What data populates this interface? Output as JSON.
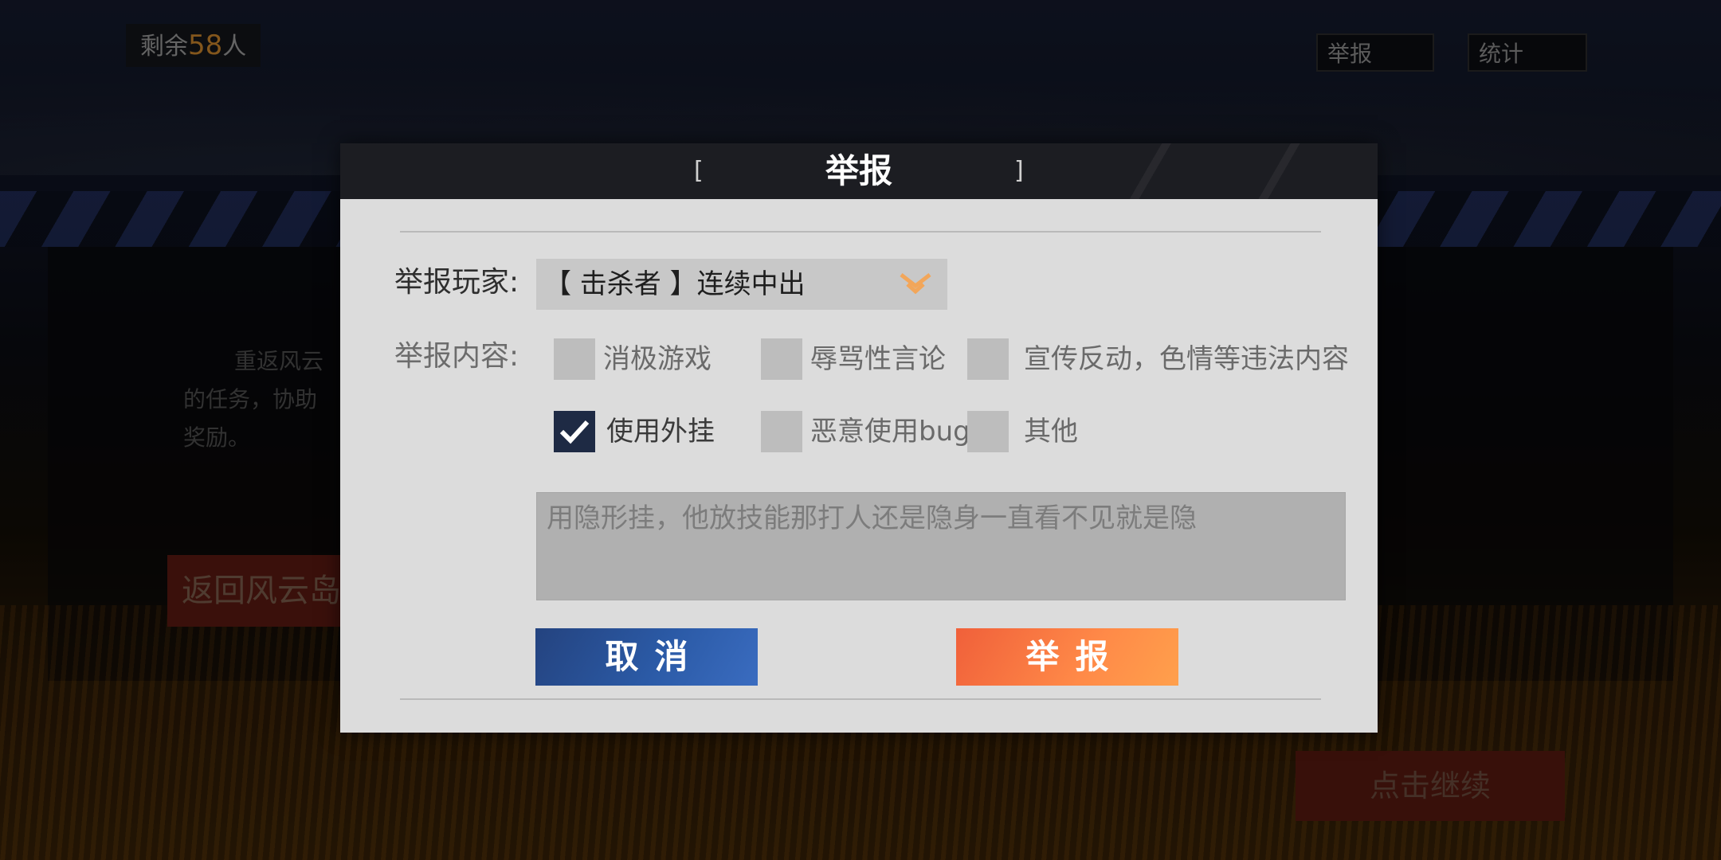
{
  "hud": {
    "remaining_prefix": "剩余",
    "remaining_count": "58",
    "remaining_suffix": "人",
    "report_label": "举报",
    "stats_label": "统计"
  },
  "background": {
    "text_line1": "重返风云",
    "text_line2": "的任务，协助",
    "text_line3": "奖励。",
    "return_label": "返回风云岛",
    "continue_label": "点击继续"
  },
  "dialog": {
    "title": "举报",
    "bracket_left": "[",
    "bracket_right": "]",
    "player_label": "举报玩家:",
    "player_selected": "【 击杀者 】连续中出",
    "content_label": "举报内容:",
    "options": [
      {
        "label": "消极游戏",
        "checked": false
      },
      {
        "label": "辱骂性言论",
        "checked": false
      },
      {
        "label": "宣传反动，色情等违法内容",
        "checked": false
      },
      {
        "label": "使用外挂",
        "checked": true
      },
      {
        "label": "恶意使用bug",
        "checked": false
      },
      {
        "label": "其他",
        "checked": false
      }
    ],
    "description": "用隐形挂，他放技能那打人还是隐身一直看不见就是隐",
    "cancel_label": "取消",
    "submit_label": "举报"
  },
  "colors": {
    "cancel": "#2b5aa6",
    "submit": "#ff8a48",
    "accent_chevron": "#f2a65a",
    "checked_box": "#1e2a44"
  }
}
